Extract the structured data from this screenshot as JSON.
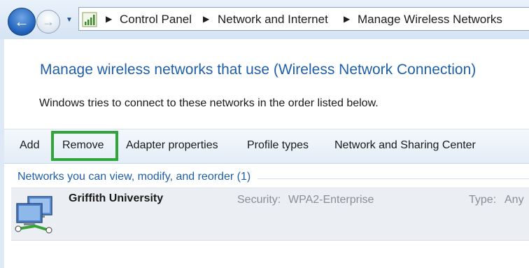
{
  "nav": {
    "breadcrumbs": [
      "Control Panel",
      "Network and Internet",
      "Manage Wireless Networks"
    ]
  },
  "page": {
    "title": "Manage wireless networks that use (Wireless Network Connection)",
    "description": "Windows tries to connect to these networks in the order listed below."
  },
  "toolbar": {
    "add_label": "Add",
    "remove_label": "Remove",
    "adapter_label": "Adapter properties",
    "profile_label": "Profile types",
    "sharing_label": "Network and Sharing Center"
  },
  "networks": {
    "group_header": "Networks you can view, modify, and reorder (1)",
    "items": [
      {
        "name": "Griffith University",
        "security_label": "Security:",
        "security_value": "WPA2-Enterprise",
        "type_label": "Type:",
        "type_value": "Any"
      }
    ]
  },
  "colors": {
    "title_blue": "#1e5fa8",
    "highlight_green": "#2fa53a"
  },
  "icons": [
    "back-arrow-icon",
    "forward-arrow-icon",
    "chevron-down-icon",
    "network-signal-icon",
    "breadcrumb-arrow-icon",
    "wireless-network-icon"
  ]
}
